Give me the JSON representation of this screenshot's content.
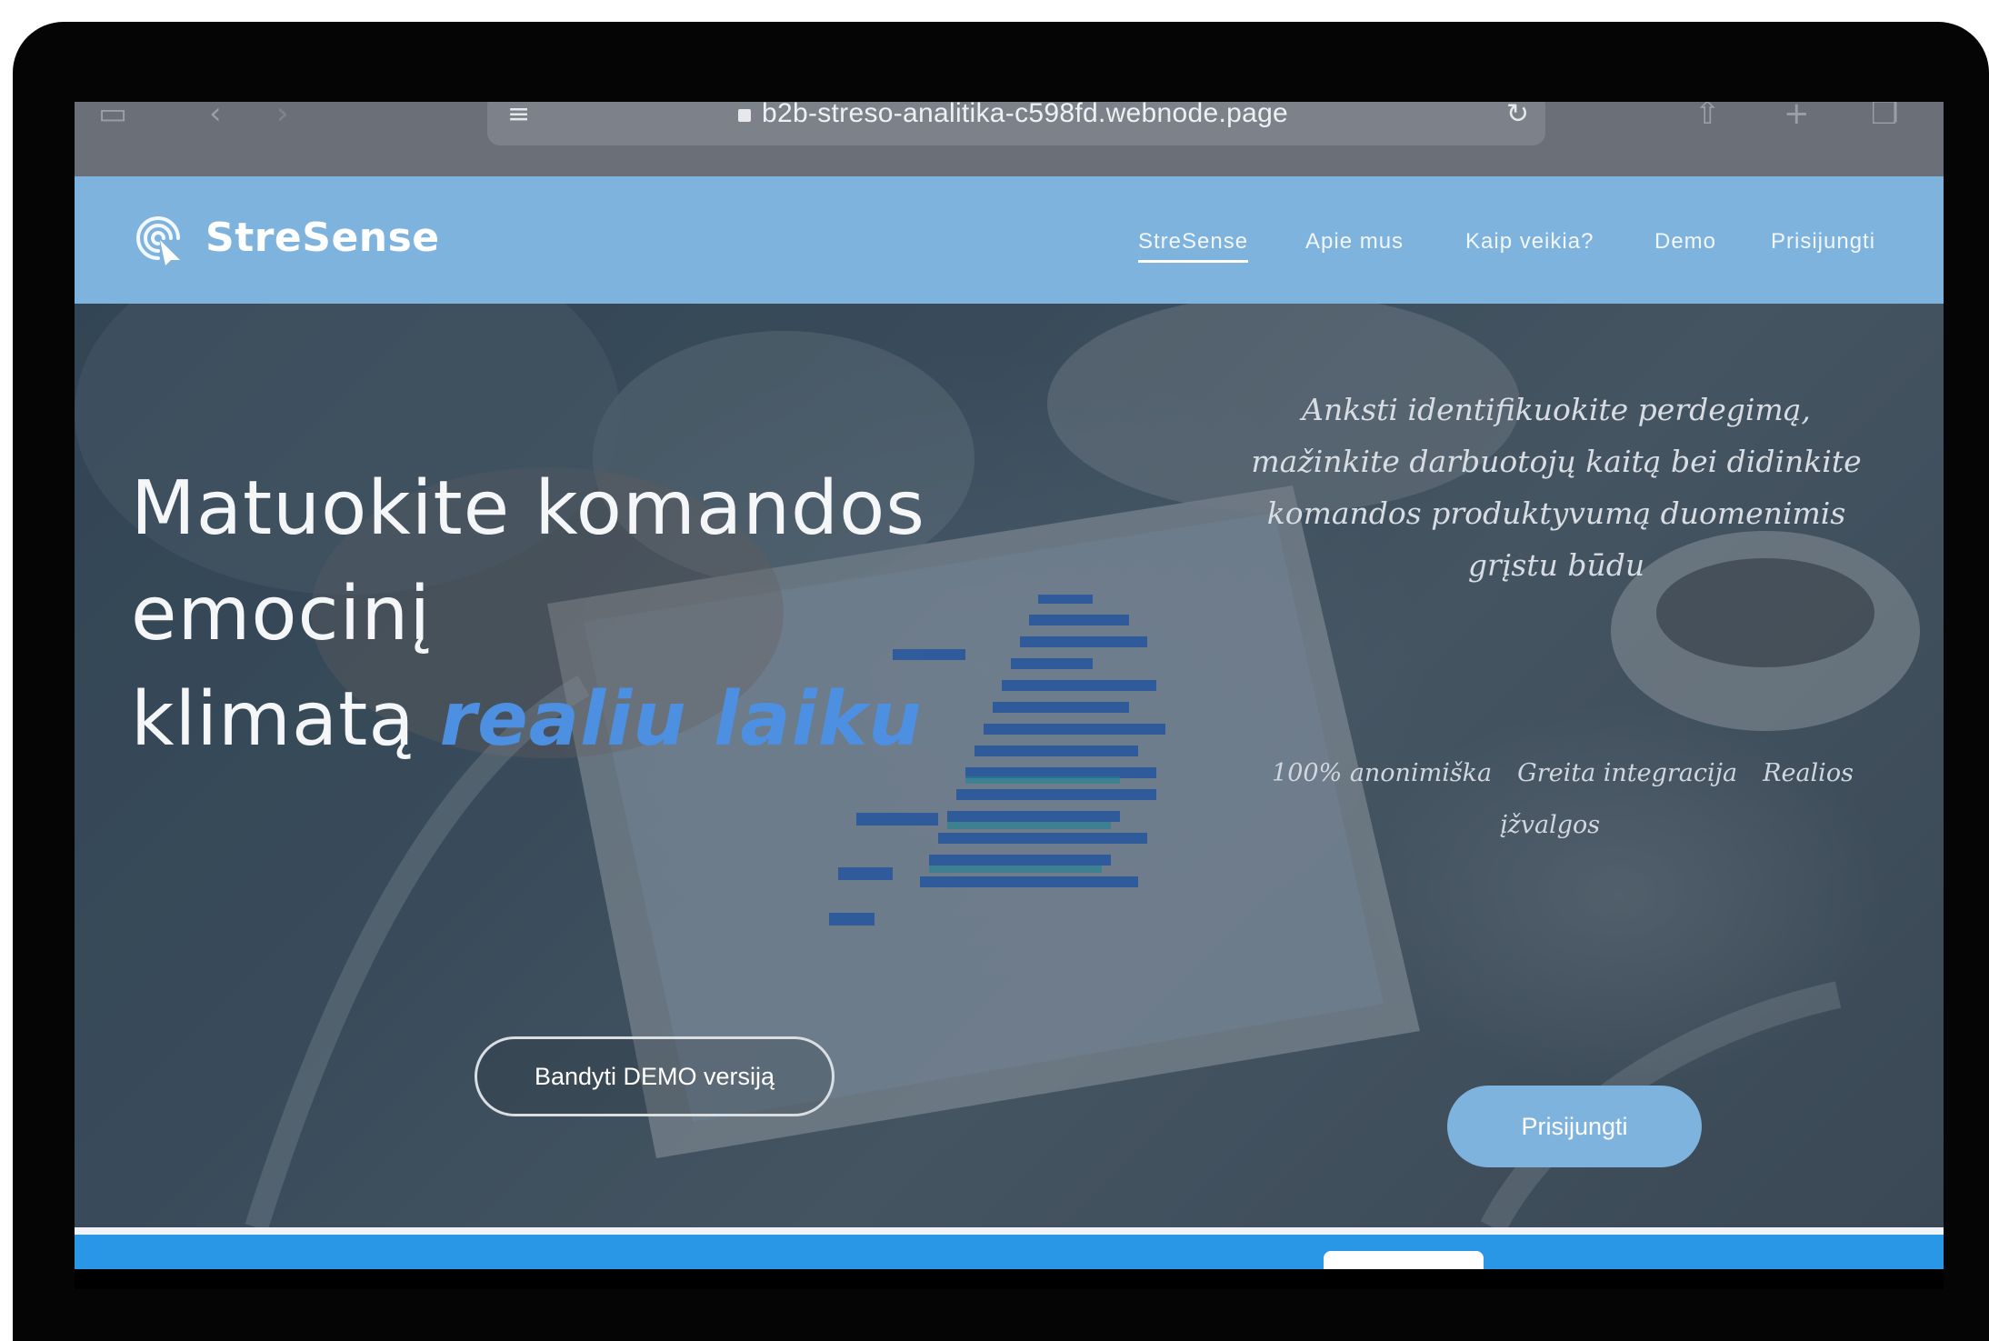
{
  "browser": {
    "url": "b2b-streso-analitika-c598fd.webnode.page"
  },
  "navbar": {
    "brand": "StreSense",
    "items": [
      {
        "label": "StreSense",
        "active": true
      },
      {
        "label": "Apie mus"
      },
      {
        "label": "Kaip veikia?"
      },
      {
        "label": "Demo"
      },
      {
        "label": "Prisijungti"
      }
    ]
  },
  "hero": {
    "headline_line1": "Matuokite komandos",
    "headline_line2": "emocinį",
    "headline_line3": "klimatą",
    "headline_accent": "realiu laiku",
    "subtext_line1": "Anksti identifikuokite perdegimą,",
    "subtext_line2": "mažinkite darbuotojų kaitą bei didinkite",
    "subtext_line3": "komandos produktyvumą duomenimis",
    "subtext_line4": "grįstu būdu",
    "features": [
      "100% anonimiška",
      "Greita integracija",
      "Realios įžvalgos"
    ],
    "demo_button": "Bandyti DEMO versiją",
    "login_button": "Prisijungti"
  },
  "colors": {
    "navbar": "#7eb3de",
    "accent": "#4d8fe0",
    "strip": "#2a97e6"
  }
}
